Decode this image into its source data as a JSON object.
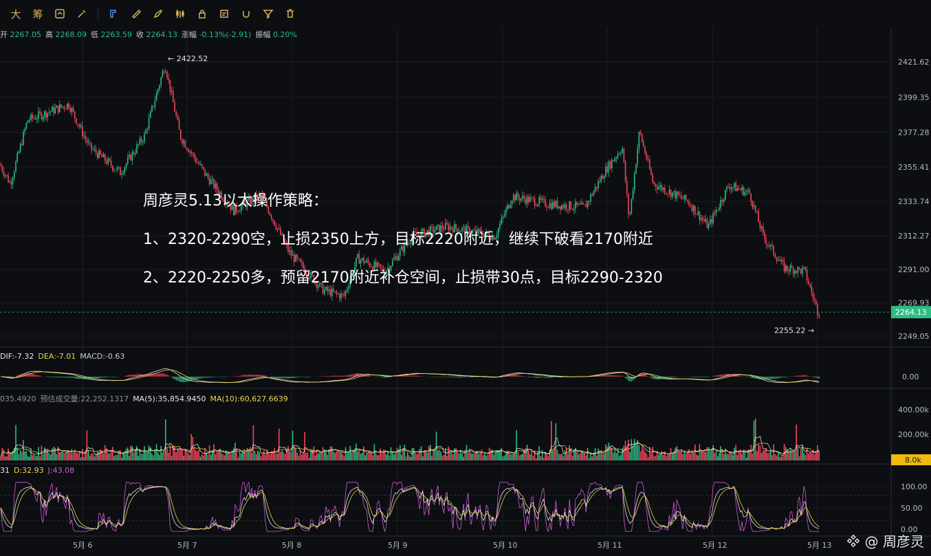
{
  "toolbar": {
    "items": [
      {
        "name": "text-big",
        "glyph": "大"
      },
      {
        "name": "text-chou",
        "glyph": "筹"
      }
    ]
  },
  "ohlc": {
    "open_label": "开",
    "open": "2267.05",
    "high_label": "高",
    "high": "2268.09",
    "low_label": "低",
    "low": "2263.59",
    "close_label": "收",
    "close": "2264.13",
    "change_label": "涨幅",
    "change": "-0.13%(-2.91)",
    "amp_label": "振幅",
    "amp": "0.20%"
  },
  "annotations": {
    "high_marker": "← 2422.52",
    "low_marker": "2255.22 →"
  },
  "price_axis": {
    "ticks": [
      "2421.62",
      "2399.35",
      "2377.28",
      "2355.41",
      "2333.74",
      "2312.27",
      "2291.00",
      "2269.93",
      "2249.05"
    ],
    "current_price": "2264.13"
  },
  "macd": {
    "dif": "DIF:-7.32",
    "dea": "DEA:-7.01",
    "macd": "MACD:-0.63",
    "axis_tick": "0.00"
  },
  "volume": {
    "vol": "035.4920",
    "estimate": "预估成交量:22,252.1317",
    "ma5": "MA(5):35,854.9450",
    "ma10": "MA(10):60,627.6639",
    "ticks": [
      "400.00k",
      "200.00k"
    ],
    "current": "8.0k"
  },
  "kdj": {
    "k": "31",
    "d": "D:32.93",
    "j": "J:43.08",
    "ticks": [
      "100.00",
      "50.00",
      "0.00"
    ]
  },
  "time_axis": {
    "labels": [
      "5月 6",
      "5月 7",
      "5月 8",
      "5月 9",
      "5月 10",
      "5月 11",
      "5月 12",
      "5月 13"
    ]
  },
  "overlay_text": {
    "line1": "周彦灵5.13以太操作策略：",
    "line2": "1、2320-2290空，止损2350上方，目标2220附近，继续下破看2170附近",
    "line3": "2、2220-2250多，预留2170附近补仓空间，止损带30点，目标2290-2320"
  },
  "watermark": {
    "text": "@ 周彦灵"
  },
  "colors": {
    "up": "#2ebd85",
    "down": "#f6465d",
    "accent": "#f0b90b",
    "ma5": "#f4f4f4",
    "ma10": "#f0d64b",
    "j_line": "#d65ad8"
  },
  "chart_data": {
    "type": "candlestick",
    "price_range": [
      2249.05,
      2421.62
    ],
    "path": [
      [
        0,
        2357
      ],
      [
        15,
        2345
      ],
      [
        40,
        2385
      ],
      [
        100,
        2395
      ],
      [
        130,
        2368
      ],
      [
        175,
        2352
      ],
      [
        210,
        2375
      ],
      [
        240,
        2420
      ],
      [
        262,
        2375
      ],
      [
        300,
        2350
      ],
      [
        340,
        2328
      ],
      [
        380,
        2338
      ],
      [
        420,
        2302
      ],
      [
        470,
        2278
      ],
      [
        500,
        2274
      ],
      [
        520,
        2298
      ],
      [
        560,
        2290
      ],
      [
        600,
        2312
      ],
      [
        650,
        2318
      ],
      [
        720,
        2312
      ],
      [
        745,
        2337
      ],
      [
        800,
        2332
      ],
      [
        850,
        2330
      ],
      [
        880,
        2353
      ],
      [
        905,
        2368
      ],
      [
        915,
        2322
      ],
      [
        930,
        2378
      ],
      [
        950,
        2345
      ],
      [
        1000,
        2334
      ],
      [
        1030,
        2318
      ],
      [
        1060,
        2344
      ],
      [
        1090,
        2339
      ],
      [
        1110,
        2312
      ],
      [
        1140,
        2292
      ],
      [
        1170,
        2290
      ],
      [
        1190,
        2264
      ]
    ]
  }
}
